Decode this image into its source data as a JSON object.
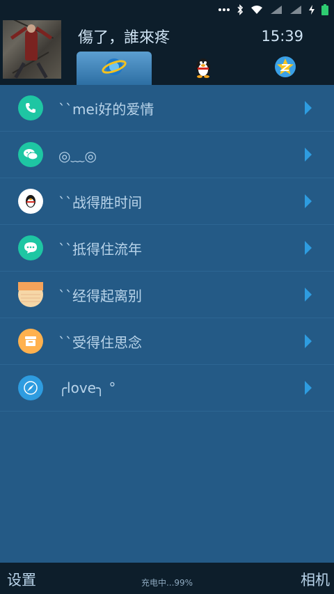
{
  "statusbar": {
    "icons": [
      "more-dots-icon",
      "bluetooth-icon",
      "wifi-icon",
      "signal-icon",
      "signal-icon",
      "charging-icon",
      "battery-icon"
    ],
    "battery_color": "#2ecc71"
  },
  "header": {
    "title": "傷了，誰來疼",
    "clock": "15:39",
    "tabs": [
      {
        "icon": "ie-browser-icon",
        "active": true
      },
      {
        "icon": "qq-penguin-icon",
        "active": false
      },
      {
        "icon": "qzone-star-icon",
        "active": false
      }
    ]
  },
  "list": [
    {
      "label": "``mei好的爱情",
      "icon": "phone-icon",
      "color": "#1ec6a3"
    },
    {
      "label": "◎﹏◎",
      "icon": "wechat-icon",
      "color": "#1ec6a3"
    },
    {
      "label": "``战得胜时间",
      "icon": "qq-icon",
      "color": "#ffffff"
    },
    {
      "label": "``抵得住流年",
      "icon": "message-icon",
      "color": "#1ec6a3"
    },
    {
      "label": "``经得起离别",
      "icon": "notes-icon",
      "color": "#f6d7a7"
    },
    {
      "label": "``受得住思念",
      "icon": "files-icon",
      "color": "#ffb14e"
    },
    {
      "label": "╭love╮ °",
      "icon": "compass-icon",
      "color": "#2e9ce0"
    }
  ],
  "bottombar": {
    "left": "设置",
    "center": "充电中...99%",
    "right": "相机"
  }
}
